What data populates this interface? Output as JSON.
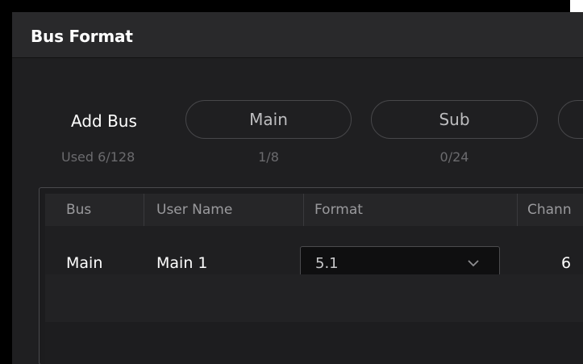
{
  "dialog": {
    "title": "Bus Format"
  },
  "add_bus": {
    "label": "Add Bus",
    "used": "Used 6/128",
    "buttons": [
      {
        "label": "Main",
        "count": "1/8"
      },
      {
        "label": "Sub",
        "count": "0/24"
      }
    ]
  },
  "table": {
    "columns": [
      "Bus",
      "User Name",
      "Format",
      "Chann"
    ],
    "rows": [
      {
        "bus": "Main",
        "user_name": "Main 1",
        "format": "5.1",
        "channels": "6"
      }
    ]
  },
  "icons": {
    "format_dropdown": "chevron-down-icon"
  },
  "colors": {
    "dialog_bg": "#1f1f21",
    "title_bar_bg": "#29292b",
    "text_primary": "#ffffff",
    "text_muted": "#6b6b6e"
  }
}
